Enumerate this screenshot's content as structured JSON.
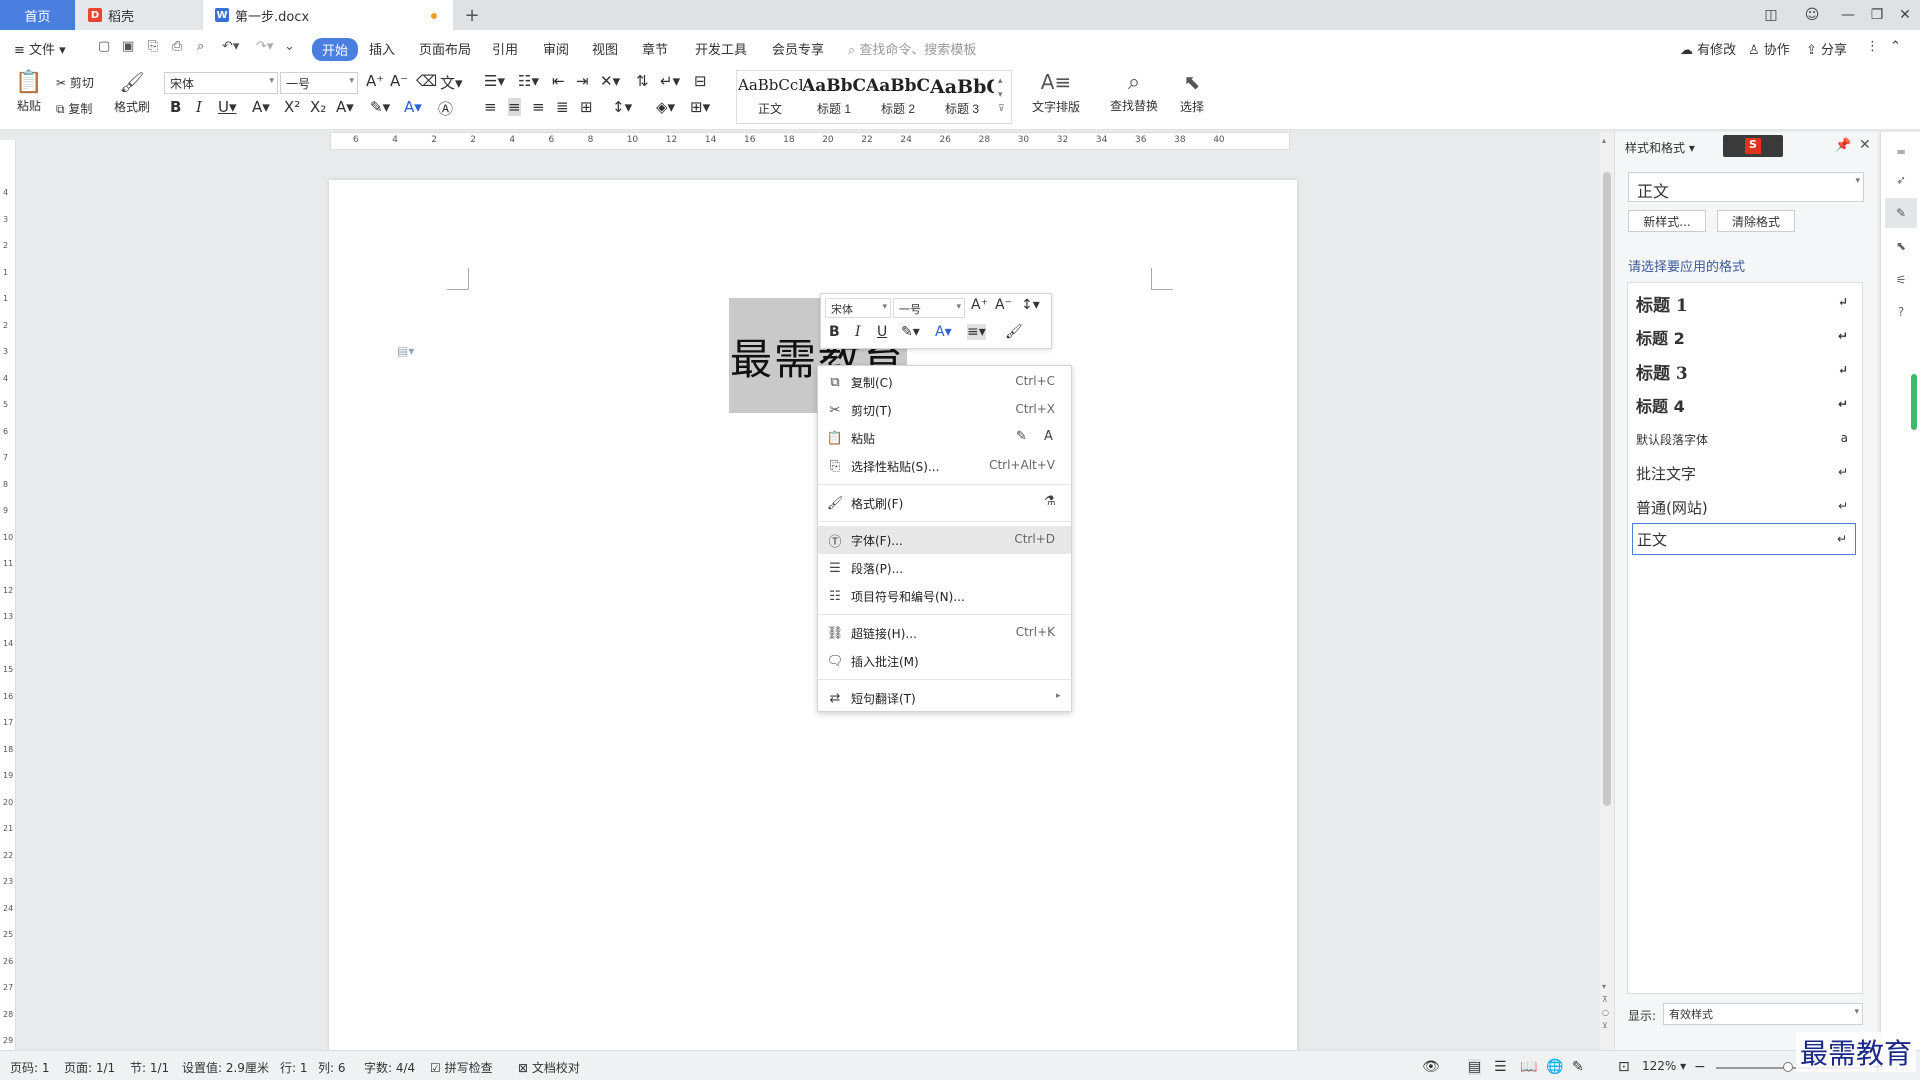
{
  "tabs": {
    "home": "首页",
    "daoke": "稻壳",
    "doc": "第一步.docx",
    "add": "+"
  },
  "menu": {
    "file": "文件",
    "items": [
      "开始",
      "插入",
      "页面布局",
      "引用",
      "审阅",
      "视图",
      "章节",
      "开发工具",
      "会员专享"
    ],
    "search_placeholder": "查找命令、搜索模板",
    "right": [
      "有修改",
      "协作",
      "分享"
    ]
  },
  "ribbon": {
    "paste": "粘贴",
    "cut": "剪切",
    "copy": "复制",
    "format_painter": "格式刷",
    "font": "宋体",
    "size": "一号",
    "styles": [
      {
        "sample": "AaBbCcI",
        "name": "正文"
      },
      {
        "sample": "AaBbC",
        "name": "标题 1"
      },
      {
        "sample": "AaBbCc",
        "name": "标题 2"
      },
      {
        "sample": "AaBbC",
        "name": "标题 3"
      }
    ],
    "text_layout": "文字排版",
    "find_replace": "查找替换",
    "select": "选择"
  },
  "ruler": {
    "h_ticks": [
      "6",
      "4",
      "2",
      "2",
      "4",
      "6",
      "8",
      "10",
      "12",
      "14",
      "16",
      "18",
      "20",
      "22",
      "24",
      "26",
      "28",
      "30",
      "32",
      "34",
      "36",
      "38",
      "40"
    ],
    "v_ticks": [
      "4",
      "3",
      "2",
      "1",
      "1",
      "2",
      "3",
      "4",
      "5",
      "6",
      "7",
      "8",
      "9",
      "10",
      "11",
      "12",
      "13",
      "14",
      "15",
      "16",
      "17",
      "18",
      "19",
      "20",
      "21",
      "22",
      "23",
      "24",
      "25",
      "26",
      "27",
      "28",
      "29"
    ]
  },
  "document": {
    "text": "最需教育"
  },
  "mini_toolbar": {
    "font": "宋体",
    "size": "一号"
  },
  "context_menu": {
    "items": [
      {
        "label": "复制(C)",
        "shortcut": "Ctrl+C"
      },
      {
        "label": "剪切(T)",
        "shortcut": "Ctrl+X"
      },
      {
        "label": "粘贴",
        "shortcut": ""
      },
      {
        "label": "选择性粘贴(S)...",
        "shortcut": "Ctrl+Alt+V"
      },
      {
        "label": "格式刷(F)",
        "shortcut": ""
      },
      {
        "label": "字体(F)...",
        "shortcut": "Ctrl+D"
      },
      {
        "label": "段落(P)...",
        "shortcut": ""
      },
      {
        "label": "项目符号和编号(N)...",
        "shortcut": ""
      },
      {
        "label": "超链接(H)...",
        "shortcut": "Ctrl+K"
      },
      {
        "label": "插入批注(M)",
        "shortcut": ""
      },
      {
        "label": "短句翻译(T)",
        "shortcut": ""
      }
    ]
  },
  "style_panel": {
    "title": "样式和格式",
    "current": "正文",
    "new_style": "新样式...",
    "clear_format": "清除格式",
    "prompt": "请选择要应用的格式",
    "styles": [
      "标题 1",
      "标题 2",
      "标题 3",
      "标题 4",
      "默认段落字体",
      "批注文字",
      "普通(网站)",
      "正文"
    ],
    "show_label": "显示:",
    "show_value": "有效样式"
  },
  "status": {
    "page_code": "页码: 1",
    "page": "页面: 1/1",
    "section": "节: 1/1",
    "setting": "设置值: 2.9厘米",
    "row": "行: 1",
    "col": "列: 6",
    "words": "字数: 4/4",
    "spell": "拼写检查",
    "doc_check": "文档校对",
    "zoom": "122%"
  },
  "watermark": "最需教育",
  "colors": {
    "accent": "#4a7fe0",
    "selection": "#c9c9c9",
    "tab_dot": "#f09b2d"
  }
}
